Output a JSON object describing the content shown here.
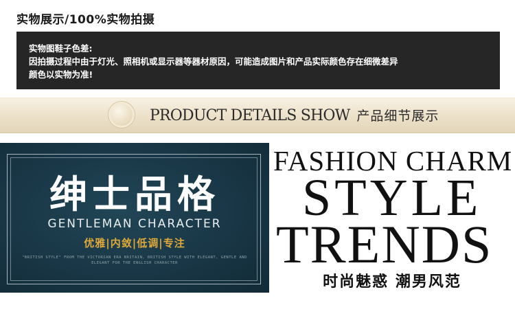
{
  "header": {
    "title": "实物展示/100%实物拍摄"
  },
  "notice": {
    "line1": "实物图鞋子色差:",
    "line2": "因拍摄过程中由于灯光、照相机或显示器等器材原因，可能造成图片和产品实际颜色存在细微差异",
    "line3": "颜色以实物为准!"
  },
  "banner": {
    "english": "PRODUCT DETAILS SHOW",
    "chinese": "产品细节展示"
  },
  "gentleman": {
    "title": "绅士品格",
    "subtitle": "GENTLEMAN CHARACTER",
    "tagline": "优雅|内敛|低调|专注",
    "fine_print": "\"BRITISH STYLE\" FROM THE VICTORIAN ERA BRITAIN, BRITISH STYLE WITH ELEGANT, GENTLE AND ELEGANT FOR THE ENGLISH CHARACTER"
  },
  "fashion": {
    "top": "FASHION CHARM",
    "big1": "STYLE",
    "big2": "TRENDS",
    "chinese": "时尚魅惑 潮男风范"
  }
}
